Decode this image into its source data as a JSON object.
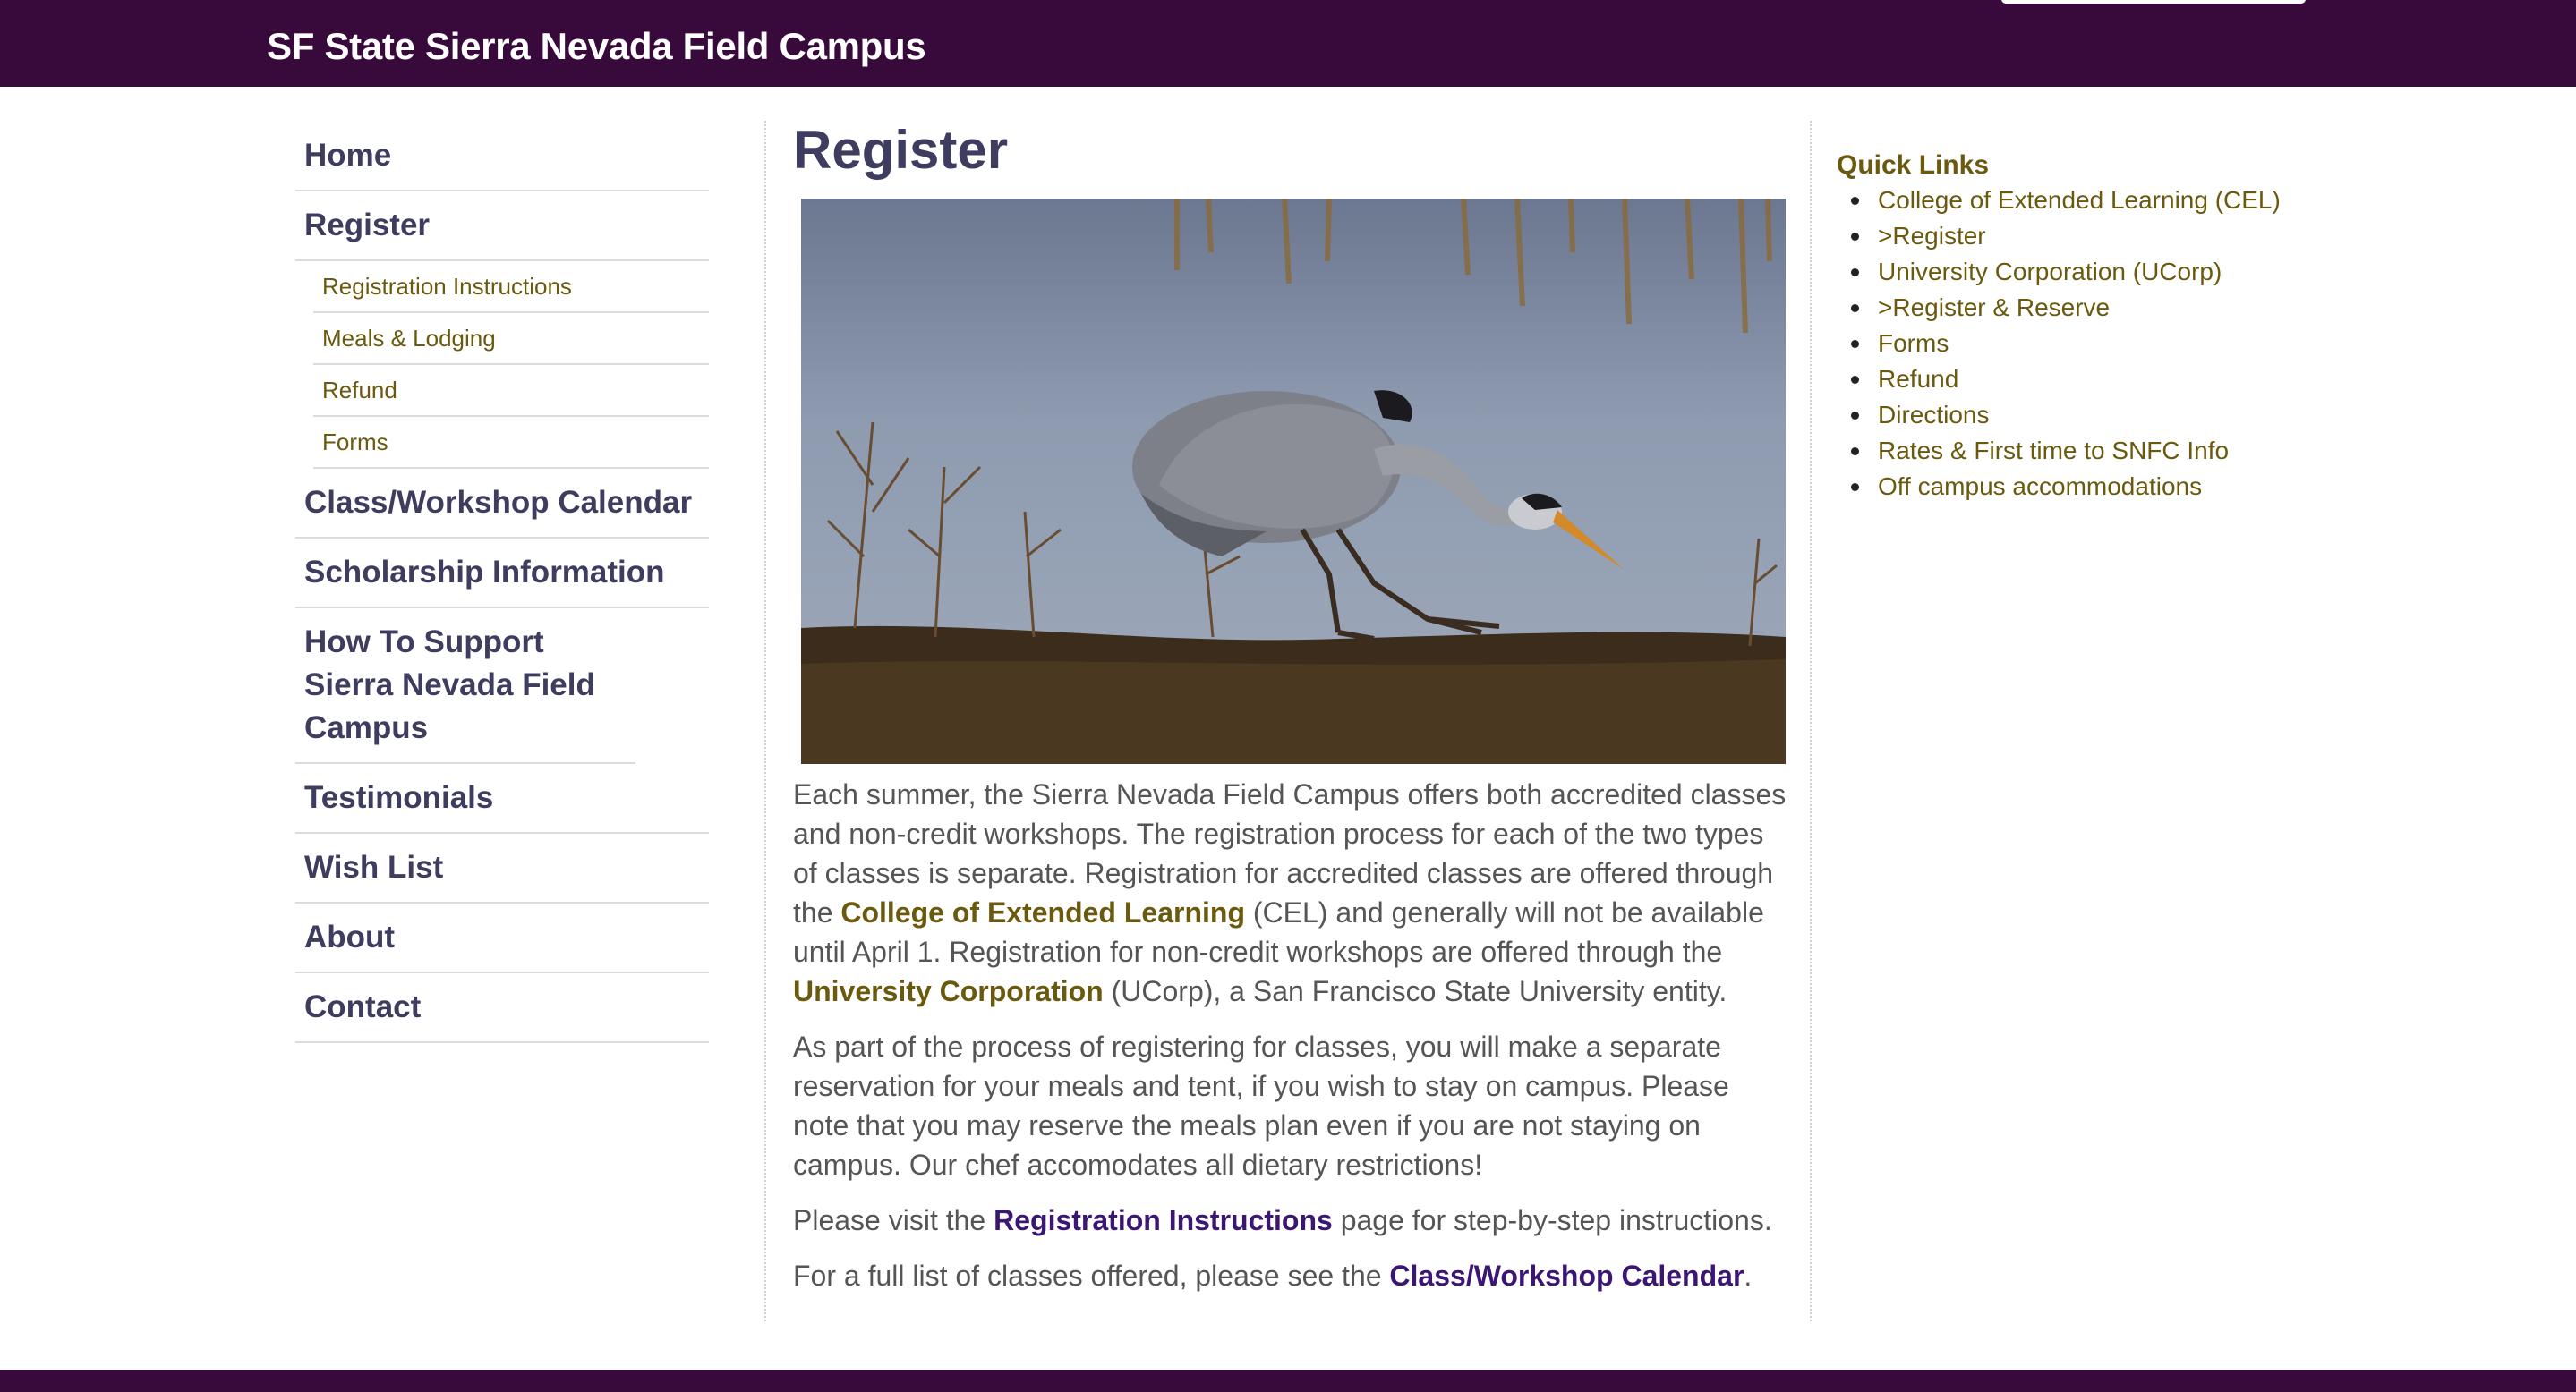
{
  "header": {
    "site_title": "SF State Sierra Nevada Field Campus"
  },
  "nav": {
    "items": [
      {
        "label": "Home"
      },
      {
        "label": "Register"
      }
    ],
    "sub_items": [
      {
        "label": "Registration Instructions"
      },
      {
        "label": "Meals & Lodging"
      },
      {
        "label": "Refund"
      },
      {
        "label": "Forms"
      }
    ],
    "items_after": [
      {
        "label": "Class/Workshop Calendar"
      },
      {
        "label": "Scholarship Information"
      },
      {
        "label": "How To Support Sierra Nevada Field Campus"
      },
      {
        "label": "Testimonials"
      },
      {
        "label": "Wish List"
      },
      {
        "label": "About"
      },
      {
        "label": "Contact"
      }
    ]
  },
  "main": {
    "title": "Register",
    "photo_alt": "heron",
    "p1": {
      "t1": "Each summer, the Sierra Nevada Field Campus offers both accredited classes and non-credit workshops. The registration process for each of the two types of classes is separate.  Registration for accredited classes are offered through the ",
      "link1": "College of Extended Learning",
      "t2": " (CEL) and generally will not be available until April 1. Registration for non-credit workshops are offered through the ",
      "link2": "University Corporation",
      "t3": " (UCorp), a San Francisco State University entity."
    },
    "p2": "As part of the process of registering for classes, you will make a separate reservation for your meals and tent, if you wish to stay on campus.  Please note that you may reserve the meals plan even if you are not staying on campus.  Our chef accomodates all dietary restrictions!",
    "p3": {
      "t1": "Please visit the ",
      "link": "Registration Instructions",
      "t2": " page for step-by-step instructions."
    },
    "p4": {
      "t1": "For a full list of classes offered, please see the ",
      "link": "Class/Workshop Calendar",
      "t2": "."
    }
  },
  "quick_links": {
    "title": "Quick Links",
    "items": [
      "College of Extended Learning (CEL)",
      ">Register",
      "University Corporation (UCorp)",
      ">Register & Reserve",
      "Forms",
      "Refund",
      "Directions",
      "Rates & First time to SNFC Info",
      "Off campus accommodations"
    ]
  },
  "colors": {
    "header_bg": "#380a3c",
    "nav_text": "#3e3d60",
    "link_olive": "#6b5a0e",
    "link_purple": "#3b1673"
  }
}
